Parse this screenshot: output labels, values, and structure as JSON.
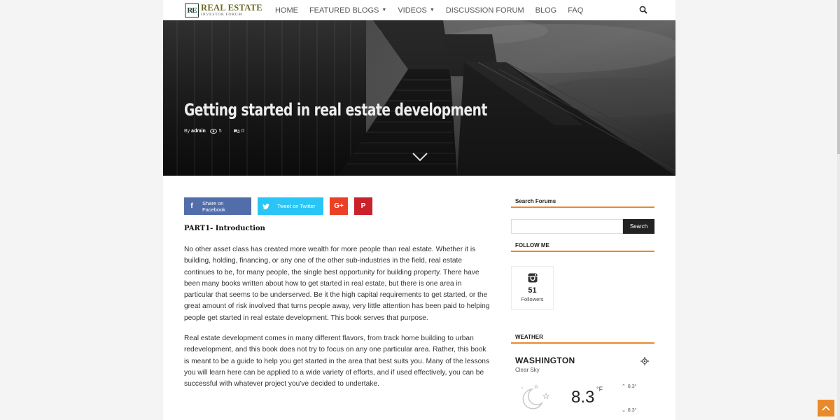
{
  "header": {
    "logo_mark": "RE",
    "logo_main": "REAL ESTATE",
    "logo_sub": "INVESTOR FORUM",
    "nav": [
      {
        "label": "HOME"
      },
      {
        "label": "FEATURED BLOGS"
      },
      {
        "label": "VIDEOS"
      },
      {
        "label": "DISCUSSION FORUM"
      },
      {
        "label": "BLOG"
      },
      {
        "label": "FAQ"
      }
    ],
    "search_icon": "search-icon"
  },
  "hero": {
    "title": "Getting started in real estate development",
    "by": "By",
    "author": "admin",
    "views": "5",
    "comments": "0"
  },
  "share": {
    "facebook": "Share on Facebook",
    "twitter": "Tweet on Twitter",
    "googleplus": "G+",
    "pinterest": "P"
  },
  "article": {
    "heading": "PART1- Introduction",
    "p1": "No other asset class has created more wealth for more people than real estate.  Whether it is building, holding, financing, or any one of the other sub-industries in the field, real estate continues to be, for many people, the single best opportunity for building property.  There have been many books written about how to get started in real estate, but there is one area in particular that seems to be underserved. Be it the high capital requirements to get started, or the great amount of risk involved that turns people away, very little attention has been paid to helping people get started in real estate development.  This book serves that purpose.",
    "p2": "Real estate development comes in many different flavors, from track home building to urban redevelopment, and this book does not try to focus on any one particular area. Rather, this book is meant to be a guide to help you get started in the area that best suits you. Many of the lessons you will learn here can be applied to a wide variety of efforts, and if used effectively, you can be successful with whatever project you've decided to undertake."
  },
  "sidebar": {
    "search_title": "Search Forums",
    "search_placeholder": "",
    "search_button": "Search",
    "follow_title": "FOLLOW ME",
    "followers_count": "51",
    "followers_label": "Followers",
    "weather_title": "WEATHER",
    "city": "WASHINGTON",
    "condition": "Clear Sky",
    "temp": "8.3",
    "unit": "°F",
    "high": "8.3°",
    "low": "8.3°"
  },
  "colors": {
    "accent": "#e88a2b",
    "facebook": "#516eab",
    "twitter": "#29c5f6",
    "googleplus": "#eb4026",
    "pinterest": "#ca212a"
  }
}
